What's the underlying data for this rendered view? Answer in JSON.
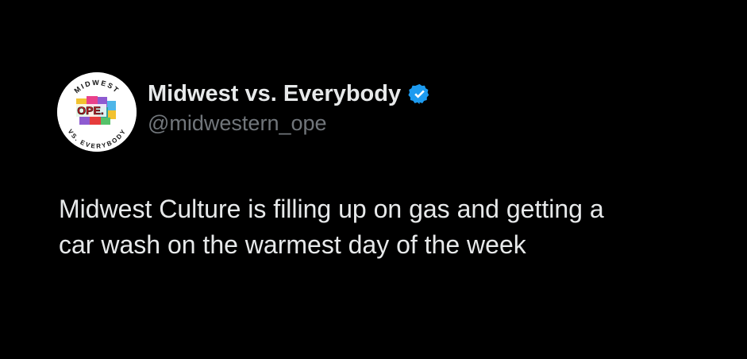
{
  "post": {
    "author": {
      "display_name": "Midwest vs. Everybody",
      "handle": "@midwestern_ope",
      "verified_icon": "verified-badge-icon",
      "avatar": {
        "top_arc_text": "MIDWEST",
        "center_text": "OPE.",
        "bottom_arc_text": "VS. EVERYBODY"
      }
    },
    "text_lines": [
      "Midwest Culture is filling up on gas and getting a",
      "car wash on the warmest day of the week"
    ]
  },
  "colors": {
    "background": "#000000",
    "text_primary": "#e7e9ea",
    "text_secondary": "#71767b",
    "verified_blue": "#1d9bf0"
  }
}
